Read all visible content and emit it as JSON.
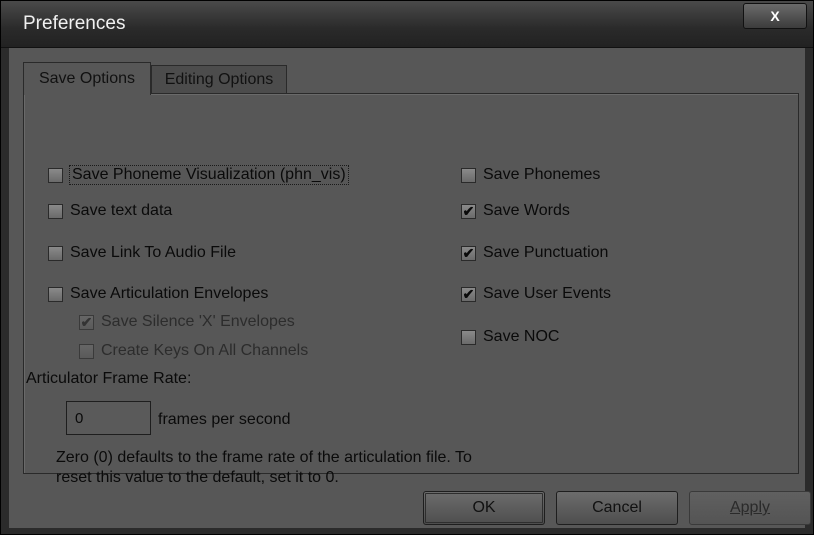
{
  "window": {
    "title": "Preferences",
    "close_symbol": "X"
  },
  "tabs": [
    {
      "label": "Save Options",
      "active": true
    },
    {
      "label": "Editing Options",
      "active": false
    }
  ],
  "left_options": [
    {
      "label": "Save Phoneme Visualization (phn_vis)",
      "checked": false
    },
    {
      "label": "Save text data",
      "checked": false
    },
    {
      "label": "Save Link To Audio File",
      "checked": false
    },
    {
      "label": "Save Articulation Envelopes",
      "checked": false
    }
  ],
  "sub_options": [
    {
      "label": "Save Silence 'X' Envelopes",
      "checked": true,
      "disabled": true
    },
    {
      "label": "Create Keys On All Channels",
      "checked": false,
      "disabled": true
    }
  ],
  "right_options": [
    {
      "label": "Save Phonemes",
      "checked": false
    },
    {
      "label": "Save Words",
      "checked": true
    },
    {
      "label": "Save Punctuation",
      "checked": true
    },
    {
      "label": "Save User Events",
      "checked": true
    },
    {
      "label": "Save NOC",
      "checked": false
    }
  ],
  "frame_rate": {
    "label": "Articulator Frame Rate:",
    "value": "0",
    "unit": "frames per second",
    "note": "Zero (0) defaults to the frame rate of the articulation file. To reset this value to the default, set it to 0."
  },
  "buttons": {
    "ok": "OK",
    "cancel": "Cancel",
    "apply": "Apply"
  },
  "check_glyph": "✔"
}
